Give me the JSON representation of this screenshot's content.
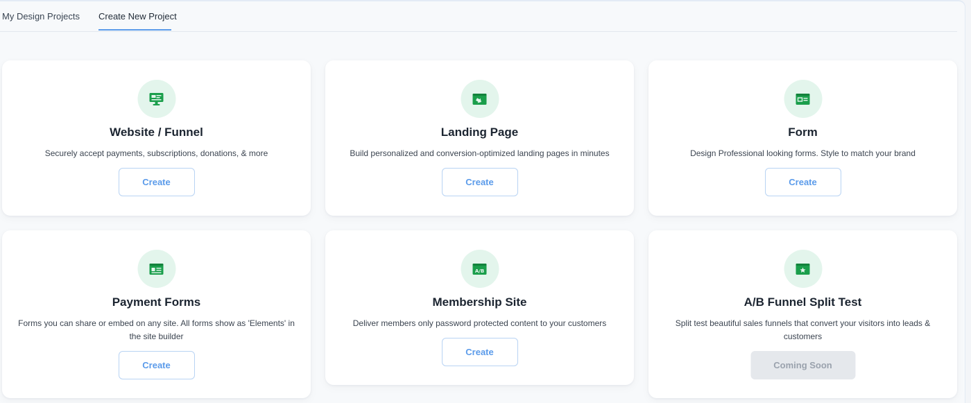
{
  "tabs": [
    {
      "label": "My Design Projects",
      "active": false
    },
    {
      "label": "Create New Project",
      "active": true
    }
  ],
  "accent": "#5b9bea",
  "icon_color": "#1a9e4b",
  "cards": [
    {
      "title": "Website / Funnel",
      "description": "Securely accept payments, subscriptions, donations, & more",
      "button": "Create",
      "icon": "website-funnel-icon"
    },
    {
      "title": "Landing Page",
      "description": "Build personalized and conversion-optimized landing pages in minutes",
      "button": "Create",
      "icon": "landing-page-icon"
    },
    {
      "title": "Form",
      "description": "Design Professional looking forms. Style to match your brand",
      "button": "Create",
      "icon": "form-icon"
    },
    {
      "title": "Payment Forms",
      "description": "Forms you can share or embed on any site. All forms show as 'Elements' in the site builder",
      "button": "Create",
      "icon": "payment-form-icon"
    },
    {
      "title": "Membership Site",
      "description": "Deliver members only password protected content to your customers",
      "button": "Create",
      "icon": "ab-membership-icon"
    },
    {
      "title": "A/B Funnel Split Test",
      "description": "Split test beautiful sales funnels that convert your visitors into leads & customers",
      "button": "Coming Soon",
      "icon": "star-window-icon"
    }
  ]
}
